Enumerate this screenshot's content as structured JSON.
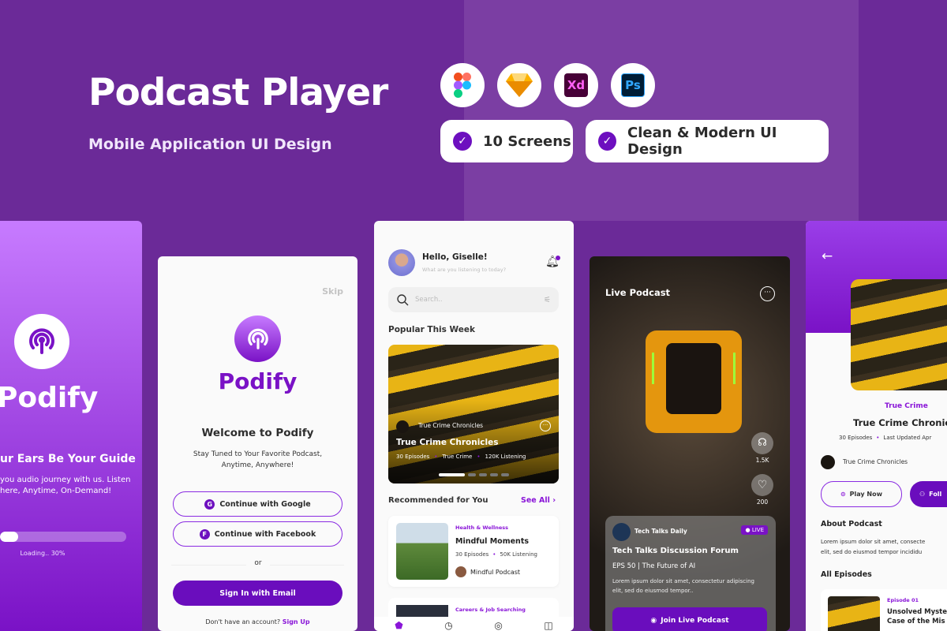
{
  "header": {
    "title": "Podcast Player",
    "subtitle": "Mobile Application UI Design",
    "tools": [
      "figma-icon",
      "sketch-icon",
      "xd-icon",
      "photoshop-icon"
    ],
    "tool_labels": {
      "xd": "Xd",
      "ps": "Ps"
    },
    "badges": [
      "10 Screens",
      "Clean & Modern UI Design"
    ]
  },
  "colors": {
    "background": "#6b2a98",
    "accent": "#6d0fbf",
    "panel": "#7b3ea3"
  },
  "splash": {
    "brand": "Podify",
    "headline": "ur Ears Be Your Guide",
    "body1": "you audio journey with us. Listen",
    "body2": "here, Anytime, On-Demand!",
    "progress": 0.3,
    "loading": "Loading.. 30%"
  },
  "welcome": {
    "skip": "Skip",
    "brand": "Podify",
    "title": "Welcome to Podify",
    "subtitle1": "Stay Tuned to Your Favorite Podcast,",
    "subtitle2": "Anytime, Anywhere!",
    "google": "Continue with Google",
    "google_icon": "G",
    "facebook": "Continue with Facebook",
    "facebook_icon": "F",
    "or": "or",
    "email": "Sign In with Email",
    "no_account": "Don't have an account?",
    "signup": "Sign Up"
  },
  "home": {
    "greeting": "Hello, Giselle!",
    "prompt": "What are you listening to today?",
    "search_placeholder": "Search..",
    "popular": "Popular This Week",
    "featured": {
      "channel": "True Crime Chronicles",
      "title": "True Crime Chronicles",
      "meta": [
        "30 Episodes",
        "True Crime",
        "120K Listening"
      ]
    },
    "recommended": "Recommended for You",
    "see_all": "See All",
    "items": [
      {
        "category": "Health & Wellness",
        "title": "Mindful Moments",
        "meta": [
          "30 Episodes",
          "50K Listening"
        ],
        "author": "Mindful Podcast"
      },
      {
        "category": "Careers & Job Searching"
      }
    ]
  },
  "live": {
    "title": "Live Podcast",
    "listeners": "1.5K",
    "likes": "200",
    "channel": "Tech Talks Daily",
    "badge": "LIVE",
    "show": "Tech Talks Discussion Forum",
    "episode": "EPS 50 | The Future of AI",
    "desc": "Lorem ipsum dolor sit amet, consectetur adipiscing elit, sed do eiusmod tempor..",
    "join": "Join Live Podcast"
  },
  "detail": {
    "category": "True Crime",
    "title": "True Crime Chronicl",
    "meta1": "30 Episodes",
    "meta2": "Last Updated Apr",
    "channel": "True Crime Chronicles",
    "play": "Play Now",
    "follow": "Foll",
    "about": "About Podcast",
    "about_text1": "Lorem ipsum dolor sit amet, consecte",
    "about_text2": "elit, sed do eiusmod tempor incididu",
    "episodes": "All Episodes",
    "episode_no": "Episode 01",
    "episode_title1": "Unsolved Myste",
    "episode_title2": "Case of the Mis"
  }
}
